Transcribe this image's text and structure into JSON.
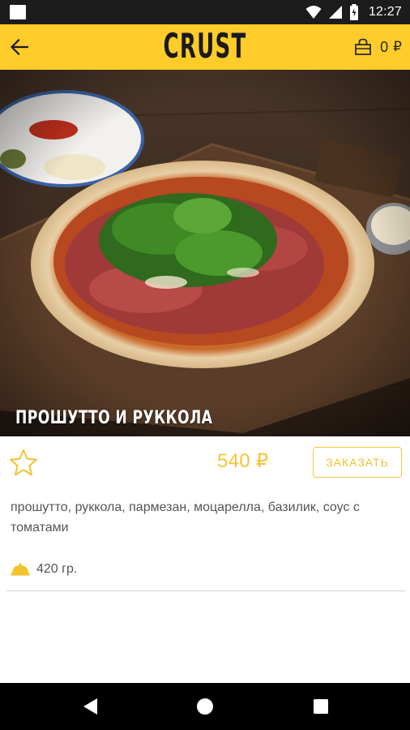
{
  "status_bar": {
    "time": "12:27"
  },
  "app_bar": {
    "brand": "CRUST",
    "cart_count": "0",
    "cart_currency": "₽"
  },
  "product": {
    "name": "ПРОШУТТО И РУККОЛА",
    "price": "540 ₽",
    "order_label": "ЗАКАЗАТЬ",
    "description": "прошутто, руккола, пармезан, моцарелла, базилик, соус с томатами",
    "weight": "420 гр."
  },
  "colors": {
    "accent": "#ffcc29",
    "price": "#f7c435",
    "text_muted": "#555555"
  },
  "icons": {
    "back": "arrow-left-icon",
    "cart": "shopping-bag-icon",
    "favorite": "star-outline-icon",
    "weight": "dish-cloche-icon",
    "nav_back": "triangle-back-icon",
    "nav_home": "circle-home-icon",
    "nav_recents": "square-recents-icon"
  }
}
